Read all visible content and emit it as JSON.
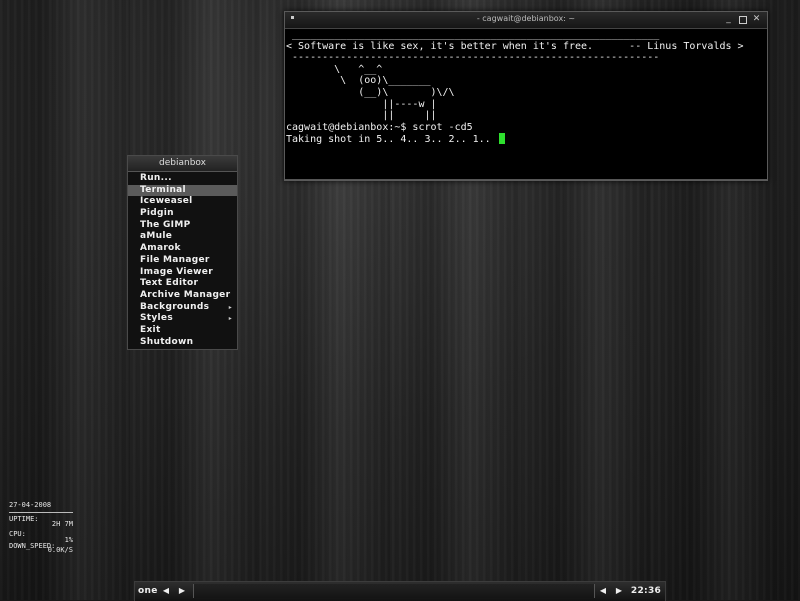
{
  "terminal": {
    "title": "- cagwait@debianbox: ~",
    "lines": [
      " _____________________________________________________________",
      "< Software is like sex, it's better when it's free.      -- Linus Torvalds >",
      " -------------------------------------------------------------",
      "        \\   ^__^",
      "         \\  (oo)\\_______",
      "            (__)\\       )\\/\\",
      "                ||----w |",
      "                ||     ||",
      "cagwait@debianbox:~$ scrot -cd5",
      "Taking shot in 5.. 4.. 3.. 2.. 1.. "
    ]
  },
  "menu": {
    "title": "debianbox",
    "items": [
      {
        "label": "Run...",
        "submenu": false,
        "active": false
      },
      {
        "label": "Terminal",
        "submenu": false,
        "active": true
      },
      {
        "label": "Iceweasel",
        "submenu": false,
        "active": false
      },
      {
        "label": "Pidgin",
        "submenu": false,
        "active": false
      },
      {
        "label": "The GIMP",
        "submenu": false,
        "active": false
      },
      {
        "label": "aMule",
        "submenu": false,
        "active": false
      },
      {
        "label": "Amarok",
        "submenu": false,
        "active": false
      },
      {
        "label": "File Manager",
        "submenu": false,
        "active": false
      },
      {
        "label": "Image Viewer",
        "submenu": false,
        "active": false
      },
      {
        "label": "Text Editor",
        "submenu": false,
        "active": false
      },
      {
        "label": "Archive Manager",
        "submenu": false,
        "active": false
      },
      {
        "label": "Backgrounds",
        "submenu": true,
        "active": false
      },
      {
        "label": "Styles",
        "submenu": true,
        "active": false
      },
      {
        "label": "Exit",
        "submenu": false,
        "active": false
      },
      {
        "label": "Shutdown",
        "submenu": false,
        "active": false
      }
    ]
  },
  "conky": {
    "date": "27-04-2008",
    "uptime_label": "UPTIME:",
    "uptime_value": "2H 7M",
    "cpu_label": "CPU:",
    "cpu_value": "1%",
    "down_label": "DOWN_SPEED:",
    "down_value": "0.0K/S"
  },
  "panel": {
    "workspace": "one",
    "clock": "22:36",
    "prev_glyph": "◀",
    "next_glyph": "▶"
  }
}
